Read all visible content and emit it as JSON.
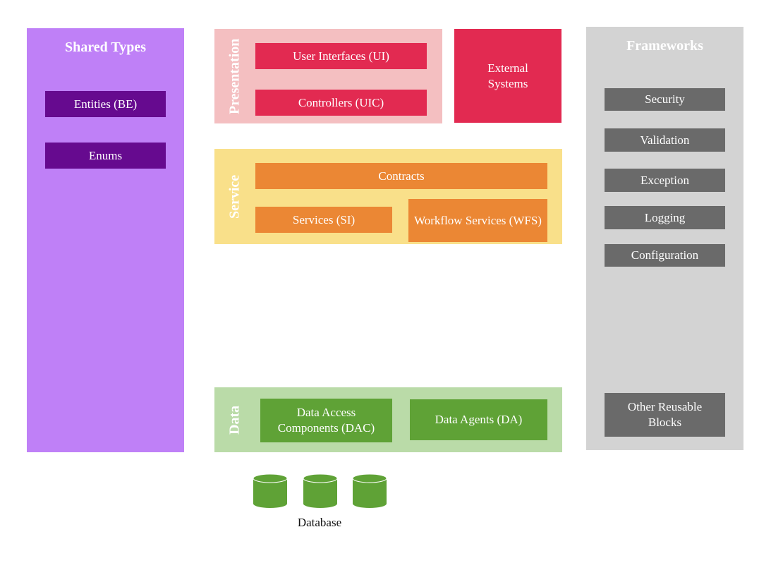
{
  "colors": {
    "shared": "#bf80f7",
    "shared_item": "#660a8f",
    "presentation": "#f4bfc1",
    "presentation_item": "#e22a51",
    "service": "#f9e08a",
    "service_item": "#eb8734",
    "data": "#badba8",
    "data_item": "#5fa236",
    "frameworks": "#d3d3d3",
    "frameworks_item": "#6a6a6a"
  },
  "shared_types": {
    "title": "Shared Types",
    "items": [
      "Entities (BE)",
      "Enums"
    ]
  },
  "presentation": {
    "label": "Presentation",
    "items": [
      "User Interfaces (UI)",
      "Controllers (UIC)"
    ]
  },
  "external": {
    "label": "External Systems"
  },
  "service": {
    "label": "Service",
    "contracts": "Contracts",
    "services": "Services (SI)",
    "workflow": "Workflow Services (WFS)"
  },
  "data": {
    "label": "Data",
    "dac": "Data Access Components (DAC)",
    "da": "Data Agents (DA)"
  },
  "database": {
    "label": "Database",
    "icon": "database-cylinder-icon"
  },
  "frameworks": {
    "title": "Frameworks",
    "items": [
      "Security",
      "Validation",
      "Exception",
      "Logging",
      "Configuration",
      "Other Reusable Blocks"
    ]
  }
}
